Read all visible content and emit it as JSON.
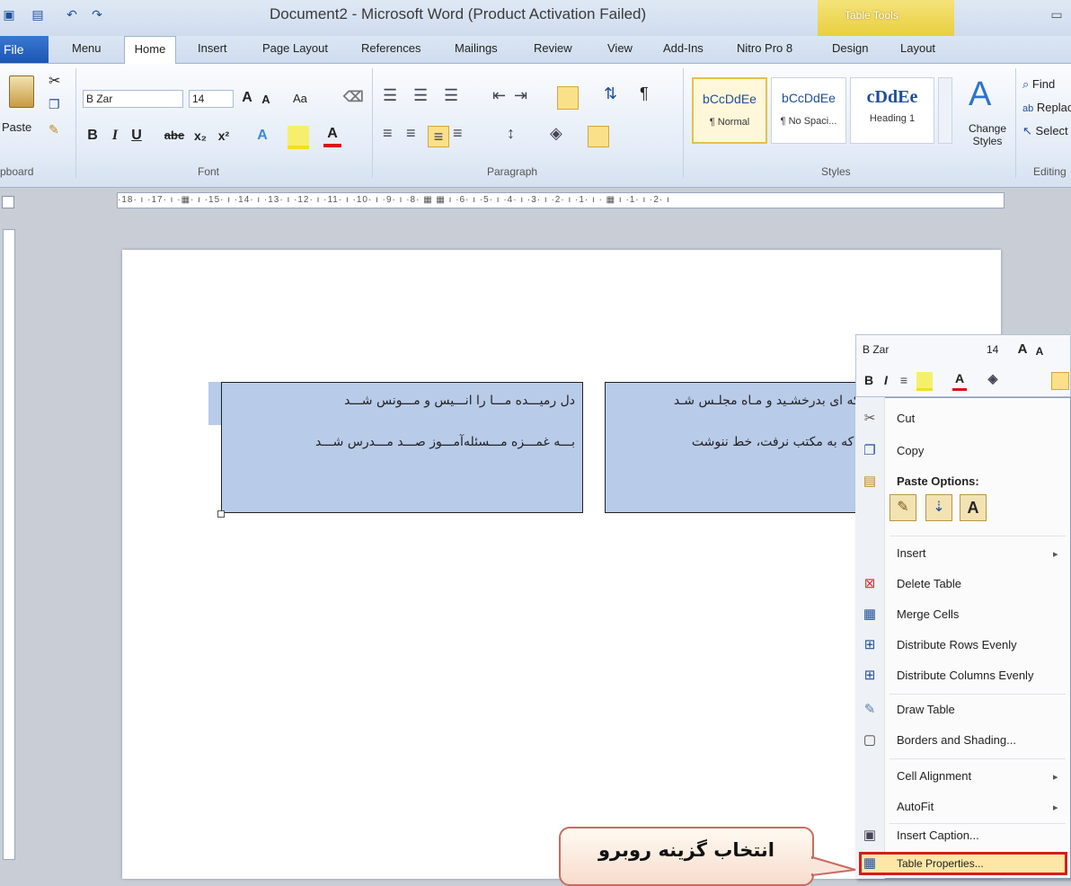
{
  "window": {
    "title": "Document2 - Microsoft Word (Product Activation Failed)",
    "context_band": "Table Tools"
  },
  "tabs": [
    "File",
    "Menu",
    "Home",
    "Insert",
    "Page Layout",
    "References",
    "Mailings",
    "Review",
    "View",
    "Add-Ins",
    "Nitro Pro 8",
    "Design",
    "Layout"
  ],
  "ribbon": {
    "clipboard": {
      "paste": "Paste",
      "label": "pboard"
    },
    "font": {
      "name": "B Zar",
      "size": "14",
      "aa": "Aa",
      "label": "Font"
    },
    "paragraph": {
      "label": "Paragraph"
    },
    "styles": {
      "items": [
        {
          "sample": "bCcDdEe",
          "name": "¶ Normal"
        },
        {
          "sample": "bCcDdEe",
          "name": "¶ No Spaci..."
        },
        {
          "sample": "cDdEe",
          "name": "Heading 1"
        }
      ],
      "change_styles": "Change Styles",
      "label": "Styles"
    },
    "editing": {
      "find": "Find",
      "replace": "Replac",
      "select": "Select",
      "label": "Editing"
    }
  },
  "ruler": "·18· ı ·17· ı ·▦· ı ·15· ı ·14· ı ·13· ı ·12· ı ·11· ı ·10· ı ·9· ı ·8· ▦ ▦ ı ·6· ı ·5· ı ·4· ı ·3· ı ·2· ı ·1· ı · ▦ ı ·1· ı ·2· ı",
  "table": {
    "left_cell": [
      "دل رمیـــده مـــا را انـــیس و مـــونس شـــد",
      "بـــه غمـــزه مـــسئله‌آمـــوز صـــد مـــدرس شـــد"
    ],
    "right_cell": [
      "نگار ما که ای بدرخشـید و مـاه مجلـس شـد",
      "نگار من که به مکتب نرفت، خط ننوشت"
    ]
  },
  "mini_toolbar": {
    "font": "B Zar",
    "size": "14"
  },
  "context_menu": {
    "items": [
      {
        "label": "Cut",
        "icon": "scissors-icon"
      },
      {
        "label": "Copy",
        "icon": "copy-icon"
      },
      {
        "label": "Paste Options:",
        "icon": "clipboard-icon"
      },
      {
        "label": "Insert",
        "icon": ""
      },
      {
        "label": "Delete Table",
        "icon": "delete-table-icon"
      },
      {
        "label": "Merge Cells",
        "icon": "merge-cells-icon"
      },
      {
        "label": "Distribute Rows Evenly",
        "icon": "distribute-rows-icon"
      },
      {
        "label": "Distribute Columns Evenly",
        "icon": "distribute-columns-icon"
      },
      {
        "label": "Draw Table",
        "icon": "pencil-icon"
      },
      {
        "label": "Borders and Shading...",
        "icon": "borders-icon"
      },
      {
        "label": "Cell Alignment",
        "icon": ""
      },
      {
        "label": "AutoFit",
        "icon": ""
      },
      {
        "label": "Insert Caption...",
        "icon": "caption-icon"
      },
      {
        "label": "Table Properties...",
        "icon": "table-properties-icon"
      }
    ]
  },
  "callout": {
    "text": "انتخاب گزینه روبرو"
  },
  "colors": {
    "selection": "#b8cbe8",
    "highlight_border": "#d21e1e",
    "file_tab": "#1b56b3"
  }
}
